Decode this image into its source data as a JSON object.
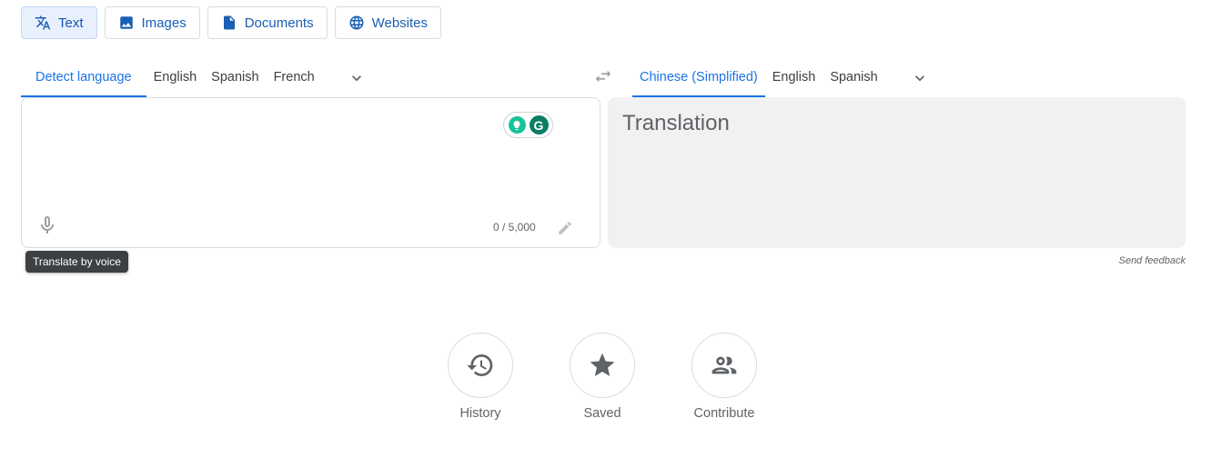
{
  "modes": [
    {
      "label": "Text",
      "icon": "translate-icon",
      "active": true
    },
    {
      "label": "Images",
      "icon": "image-icon",
      "active": false
    },
    {
      "label": "Documents",
      "icon": "document-icon",
      "active": false
    },
    {
      "label": "Websites",
      "icon": "globe-icon",
      "active": false
    }
  ],
  "source_langs": {
    "tabs": [
      "Detect language",
      "English",
      "Spanish",
      "French"
    ],
    "active_index": 0
  },
  "target_langs": {
    "tabs": [
      "Chinese (Simplified)",
      "English",
      "Spanish"
    ],
    "active_index": 0
  },
  "source": {
    "placeholder": "",
    "char_count": "0 / 5,000",
    "grammarly_letter": "G"
  },
  "target": {
    "placeholder": "Translation"
  },
  "tooltip": "Translate by voice",
  "feedback": "Send feedback",
  "actions": [
    {
      "label": "History",
      "icon": "history-icon"
    },
    {
      "label": "Saved",
      "icon": "star-icon"
    },
    {
      "label": "Contribute",
      "icon": "people-icon"
    }
  ],
  "colors": {
    "accent": "#1a73e8",
    "active_mode_bg": "#e8f0fe",
    "target_bg": "#f1f1f1",
    "grammarly_green": "#15c39a"
  }
}
